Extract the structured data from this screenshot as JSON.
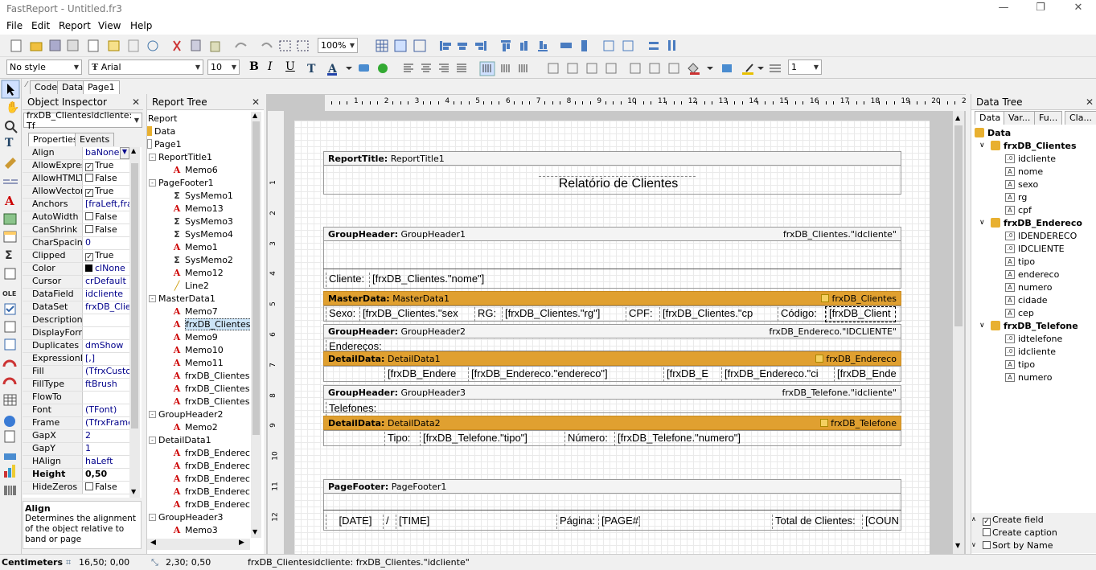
{
  "app": {
    "title": "FastReport - Untitled.fr3"
  },
  "menu": [
    "File",
    "Edit",
    "Report",
    "View",
    "Help"
  ],
  "toolbar": {
    "zoom": "100%",
    "style": "No style",
    "font": "Arial",
    "size": "10",
    "frame_width": "1"
  },
  "tabs": [
    "Code",
    "Data",
    "Page1"
  ],
  "object_inspector": {
    "title": "Object Inspector",
    "selected": "frxDB_Clientesidcliente: Tf",
    "tab_properties": "Properties",
    "tab_events": "Events",
    "props": [
      {
        "n": "Align",
        "v": "baNone"
      },
      {
        "n": "AllowExpress",
        "v": "True",
        "cb": true
      },
      {
        "n": "AllowHTMLTa",
        "v": "False",
        "cb": false
      },
      {
        "n": "AllowVectorE",
        "v": "True",
        "cb": true
      },
      {
        "n": "Anchors",
        "v": "[fraLeft,fra",
        "plus": true
      },
      {
        "n": "AutoWidth",
        "v": "False",
        "cb": false
      },
      {
        "n": "CanShrink",
        "v": "False",
        "cb": false
      },
      {
        "n": "CharSpacing",
        "v": "0"
      },
      {
        "n": "Clipped",
        "v": "True",
        "cb": true
      },
      {
        "n": "Color",
        "v": "clNone",
        "sw": true
      },
      {
        "n": "Cursor",
        "v": "crDefault"
      },
      {
        "n": "DataField",
        "v": "idcliente"
      },
      {
        "n": "DataSet",
        "v": "frxDB_Clien"
      },
      {
        "n": "Description",
        "v": ""
      },
      {
        "n": "DisplayForma",
        "v": "",
        "plus": true
      },
      {
        "n": "Duplicates",
        "v": "dmShow"
      },
      {
        "n": "ExpressionDe",
        "v": "[,]"
      },
      {
        "n": "Fill",
        "v": "(TfrxCusto",
        "plus": true
      },
      {
        "n": "FillType",
        "v": "ftBrush"
      },
      {
        "n": "FlowTo",
        "v": ""
      },
      {
        "n": "Font",
        "v": "(TFont)",
        "plus": true
      },
      {
        "n": "Frame",
        "v": "(TfrxFrame",
        "plus": true
      },
      {
        "n": "GapX",
        "v": "2"
      },
      {
        "n": "GapY",
        "v": "1"
      },
      {
        "n": "HAlign",
        "v": "haLeft"
      },
      {
        "n": "Height",
        "v": "0,50",
        "bold": true
      },
      {
        "n": "HideZeros",
        "v": "False",
        "cb": false
      }
    ],
    "help_title": "Align",
    "help_text": "Determines the alignment of the object relative to band or page"
  },
  "report_tree": {
    "title": "Report Tree",
    "nodes": [
      {
        "t": "Report",
        "l": 0,
        "i": "none"
      },
      {
        "t": "Data",
        "l": 0,
        "i": "db"
      },
      {
        "t": "Page1",
        "l": 0,
        "i": "page"
      },
      {
        "t": "ReportTitle1",
        "l": 1,
        "i": "band",
        "e": "-"
      },
      {
        "t": "Memo6",
        "l": 2,
        "i": "A"
      },
      {
        "t": "PageFooter1",
        "l": 1,
        "i": "band",
        "e": "-"
      },
      {
        "t": "SysMemo1",
        "l": 2,
        "i": "S"
      },
      {
        "t": "Memo13",
        "l": 2,
        "i": "A"
      },
      {
        "t": "SysMemo3",
        "l": 2,
        "i": "S"
      },
      {
        "t": "SysMemo4",
        "l": 2,
        "i": "S"
      },
      {
        "t": "Memo1",
        "l": 2,
        "i": "A"
      },
      {
        "t": "SysMemo2",
        "l": 2,
        "i": "S"
      },
      {
        "t": "Memo12",
        "l": 2,
        "i": "A"
      },
      {
        "t": "Line2",
        "l": 2,
        "i": "L"
      },
      {
        "t": "MasterData1",
        "l": 1,
        "i": "band",
        "e": "-"
      },
      {
        "t": "Memo7",
        "l": 2,
        "i": "A"
      },
      {
        "t": "frxDB_Clientesid",
        "l": 2,
        "i": "A",
        "sel": true
      },
      {
        "t": "Memo9",
        "l": 2,
        "i": "A"
      },
      {
        "t": "Memo10",
        "l": 2,
        "i": "A"
      },
      {
        "t": "Memo11",
        "l": 2,
        "i": "A"
      },
      {
        "t": "frxDB_Clientess",
        "l": 2,
        "i": "A"
      },
      {
        "t": "frxDB_Clientesc",
        "l": 2,
        "i": "A"
      },
      {
        "t": "frxDB_Clientesr",
        "l": 2,
        "i": "A"
      },
      {
        "t": "GroupHeader2",
        "l": 1,
        "i": "band",
        "e": "-"
      },
      {
        "t": "Memo2",
        "l": 2,
        "i": "A"
      },
      {
        "t": "DetailData1",
        "l": 1,
        "i": "band",
        "e": "-"
      },
      {
        "t": "frxDB_Endereco",
        "l": 2,
        "i": "A"
      },
      {
        "t": "frxDB_Endereco",
        "l": 2,
        "i": "A"
      },
      {
        "t": "frxDB_Endereco",
        "l": 2,
        "i": "A"
      },
      {
        "t": "frxDB_Endereco",
        "l": 2,
        "i": "A"
      },
      {
        "t": "frxDB_Endereco",
        "l": 2,
        "i": "A"
      },
      {
        "t": "GroupHeader3",
        "l": 1,
        "i": "band",
        "e": "-"
      },
      {
        "t": "Memo3",
        "l": 2,
        "i": "A"
      }
    ]
  },
  "ruler": [
    "1",
    "2",
    "3",
    "4",
    "5",
    "6",
    "7",
    "8",
    "9",
    "10",
    "11",
    "12",
    "13",
    "14",
    "15",
    "16",
    "17",
    "18",
    "19",
    "20",
    "2"
  ],
  "vruler": [
    "1",
    "2",
    "3",
    "4",
    "5",
    "6",
    "7",
    "8",
    "9",
    "10",
    "11",
    "12"
  ],
  "bands": [
    {
      "label": "ReportTitle:",
      "name": "ReportTitle1",
      "right": "",
      "orange": false
    },
    {
      "label": "GroupHeader:",
      "name": "GroupHeader1",
      "right": "frxDB_Clientes.\"idcliente\"",
      "orange": false
    },
    {
      "label": "MasterData:",
      "name": "MasterData1",
      "right": "frxDB_Clientes",
      "orange": true
    },
    {
      "label": "GroupHeader:",
      "name": "GroupHeader2",
      "right": "frxDB_Endereco.\"IDCLIENTE\"",
      "orange": false
    },
    {
      "label": "DetailData:",
      "name": "DetailData1",
      "right": "frxDB_Endereco",
      "orange": true
    },
    {
      "label": "GroupHeader:",
      "name": "GroupHeader3",
      "right": "frxDB_Telefone.\"idcliente\"",
      "orange": false
    },
    {
      "label": "DetailData:",
      "name": "DetailData2",
      "right": "frxDB_Telefone",
      "orange": true
    },
    {
      "label": "PageFooter:",
      "name": "PageFooter1",
      "right": "",
      "orange": false
    }
  ],
  "memos": {
    "title": "Relatório de Clientes",
    "cliente": "Cliente:",
    "cliente_v": "[frxDB_Clientes.\"nome\"]",
    "sexo": "Sexo:",
    "sexo_v": "[frxDB_Clientes.\"sex",
    "rg": "RG:",
    "rg_v": "[frxDB_Clientes.\"rg\"]",
    "cpf": "CPF:",
    "cpf_v": "[frxDB_Clientes.\"cp",
    "codigo": "Código:",
    "codigo_v": "[frxDB_Client",
    "enderecos": "Endereços:",
    "end1": "[frxDB_Endere",
    "end2": "[frxDB_Endereco.\"endereco\"]",
    "end3": "[frxDB_E",
    "end4": "[frxDB_Endereco.\"ci",
    "end5": "[frxDB_Ende",
    "telefones": "Telefones:",
    "tipo": "Tipo:",
    "tipo_v": "[frxDB_Telefone.\"tipo\"]",
    "numero": "Número:",
    "numero_v": "[frxDB_Telefone.\"numero\"]",
    "date": "[DATE]",
    "slash": "/",
    "time": "[TIME]",
    "pagina": "Página:",
    "page": "[PAGE#]",
    "total": "Total de Clientes:",
    "count": "[COUN"
  },
  "data_tree": {
    "title": "Data Tree",
    "tabs": [
      "Data",
      "Var...",
      "Fu...",
      "Cla..."
    ],
    "nodes": [
      {
        "t": "Data",
        "l": 0,
        "k": "db",
        "bold": true
      },
      {
        "t": "frxDB_Clientes",
        "l": 1,
        "k": "db",
        "bold": true
      },
      {
        "t": "idcliente",
        "l": 2,
        "k": "n"
      },
      {
        "t": "nome",
        "l": 2,
        "k": "A"
      },
      {
        "t": "sexo",
        "l": 2,
        "k": "A"
      },
      {
        "t": "rg",
        "l": 2,
        "k": "A"
      },
      {
        "t": "cpf",
        "l": 2,
        "k": "A"
      },
      {
        "t": "frxDB_Endereco",
        "l": 1,
        "k": "db",
        "bold": true
      },
      {
        "t": "IDENDERECO",
        "l": 2,
        "k": "n"
      },
      {
        "t": "IDCLIENTE",
        "l": 2,
        "k": "n"
      },
      {
        "t": "tipo",
        "l": 2,
        "k": "A"
      },
      {
        "t": "endereco",
        "l": 2,
        "k": "A"
      },
      {
        "t": "numero",
        "l": 2,
        "k": "A"
      },
      {
        "t": "cidade",
        "l": 2,
        "k": "A"
      },
      {
        "t": "cep",
        "l": 2,
        "k": "A"
      },
      {
        "t": "frxDB_Telefone",
        "l": 1,
        "k": "db",
        "bold": true
      },
      {
        "t": "idtelefone",
        "l": 2,
        "k": "n"
      },
      {
        "t": "idcliente",
        "l": 2,
        "k": "n"
      },
      {
        "t": "tipo",
        "l": 2,
        "k": "A"
      },
      {
        "t": "numero",
        "l": 2,
        "k": "A"
      }
    ],
    "create_field": "Create field",
    "create_caption": "Create caption",
    "sort_by_name": "Sort by Name"
  },
  "status": {
    "units": "Centimeters",
    "pos": "16,50; 0,00",
    "size": "2,30; 0,50",
    "info": "frxDB_Clientesidcliente: frxDB_Clientes.\"idcliente\""
  }
}
